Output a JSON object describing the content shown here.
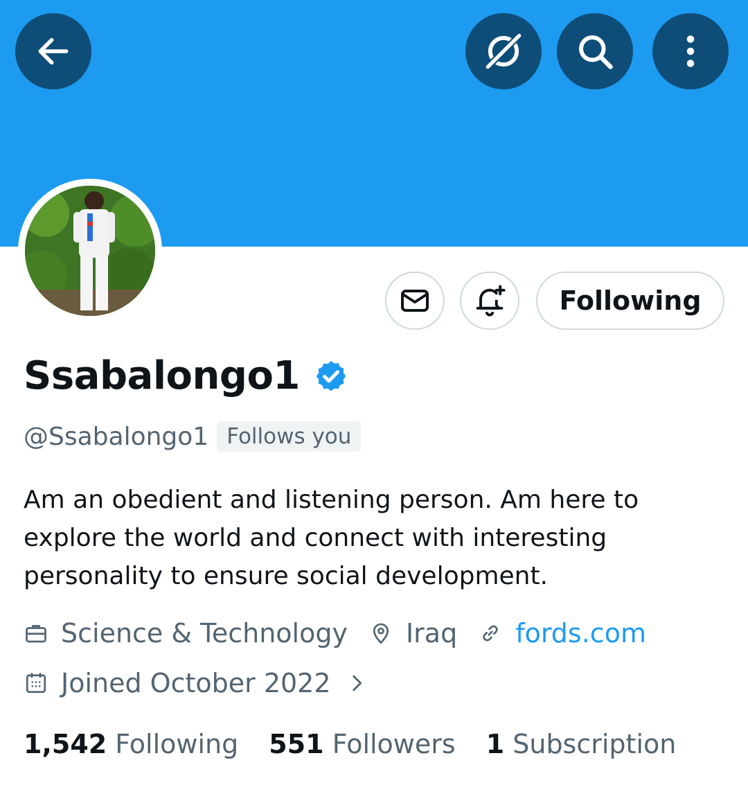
{
  "colors": {
    "accent": "#1d9bf0",
    "banner": "#1d9bf0",
    "text_primary": "#0f1419",
    "text_secondary": "#536471"
  },
  "header": {
    "icons": [
      "back-arrow-icon",
      "grok-icon",
      "search-icon",
      "more-vertical-icon"
    ]
  },
  "profile": {
    "display_name": "Ssabalongo1",
    "verified_icon": "verified-badge-icon",
    "handle": "@Ssabalongo1",
    "follows_you": "Follows you",
    "bio": "Am an obedient and listening person. Am here to explore the world and connect with interesting personality to ensure social development.",
    "category": "Science & Technology",
    "location": "Iraq",
    "website": "fords.com",
    "joined": "Joined October 2022"
  },
  "actions": {
    "message_icon": "envelope-icon",
    "notify_icon": "bell-plus-icon",
    "follow_label": "Following"
  },
  "stats": {
    "following_count": "1,542",
    "following_label": "Following",
    "followers_count": "551",
    "followers_label": "Followers",
    "subscriptions_count": "1",
    "subscriptions_label": "Subscription"
  }
}
